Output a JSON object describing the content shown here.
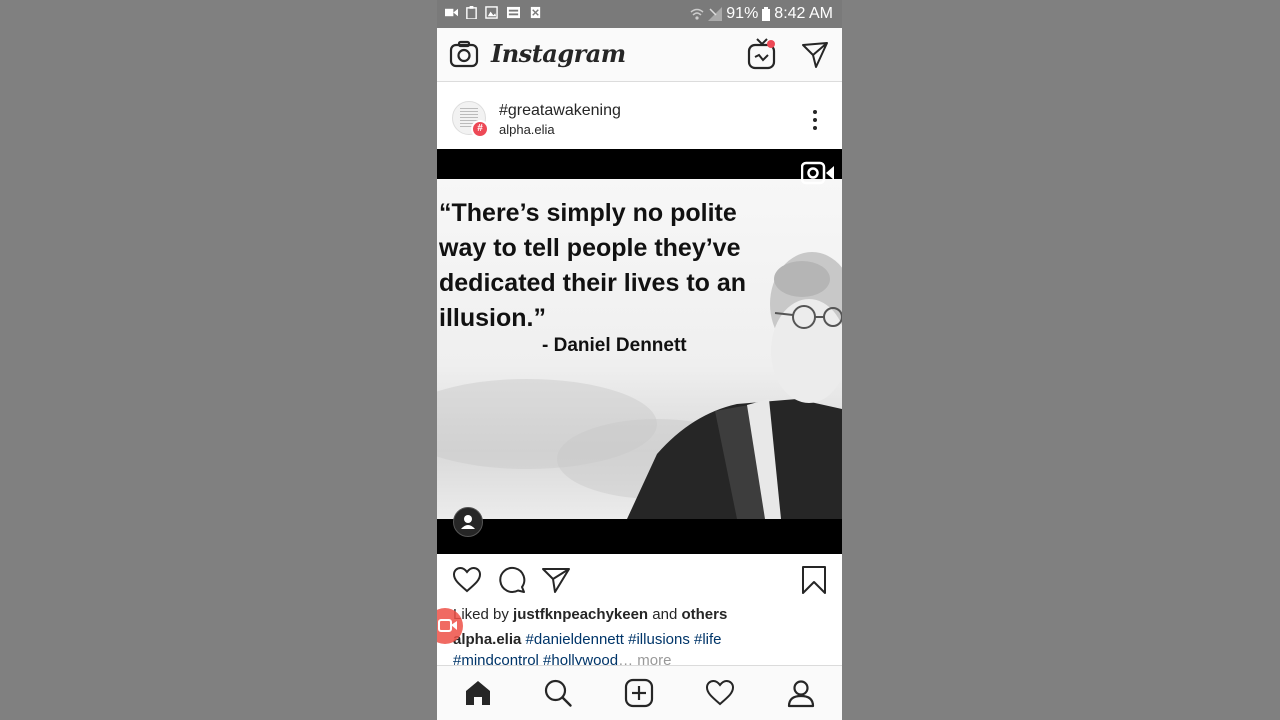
{
  "status_bar": {
    "battery": "91%",
    "time": "8:42 AM"
  },
  "app": {
    "logo": "Instagram"
  },
  "post": {
    "title": "#greatawakening",
    "subtitle": "alpha.elia",
    "badge": "#",
    "image": {
      "quote": "“There’s simply no polite way to tell people they’ve dedicated their lives to an illusion.”",
      "author": "- Daniel Dennett"
    },
    "likes": {
      "prefix": "Liked by ",
      "user": "justfknpeachykeen",
      "middle": " and ",
      "others": "others"
    },
    "caption": {
      "user": "alpha.elia",
      "tags_line1": " #danieldennett #illusions #life",
      "tags_line2": "#mindcontrol #hollywood",
      "ellipsis": "… ",
      "more": "more"
    }
  },
  "colors": {
    "notification": "#ed4956",
    "hashtag": "#003569",
    "status_bar": "#7a7a7a"
  }
}
